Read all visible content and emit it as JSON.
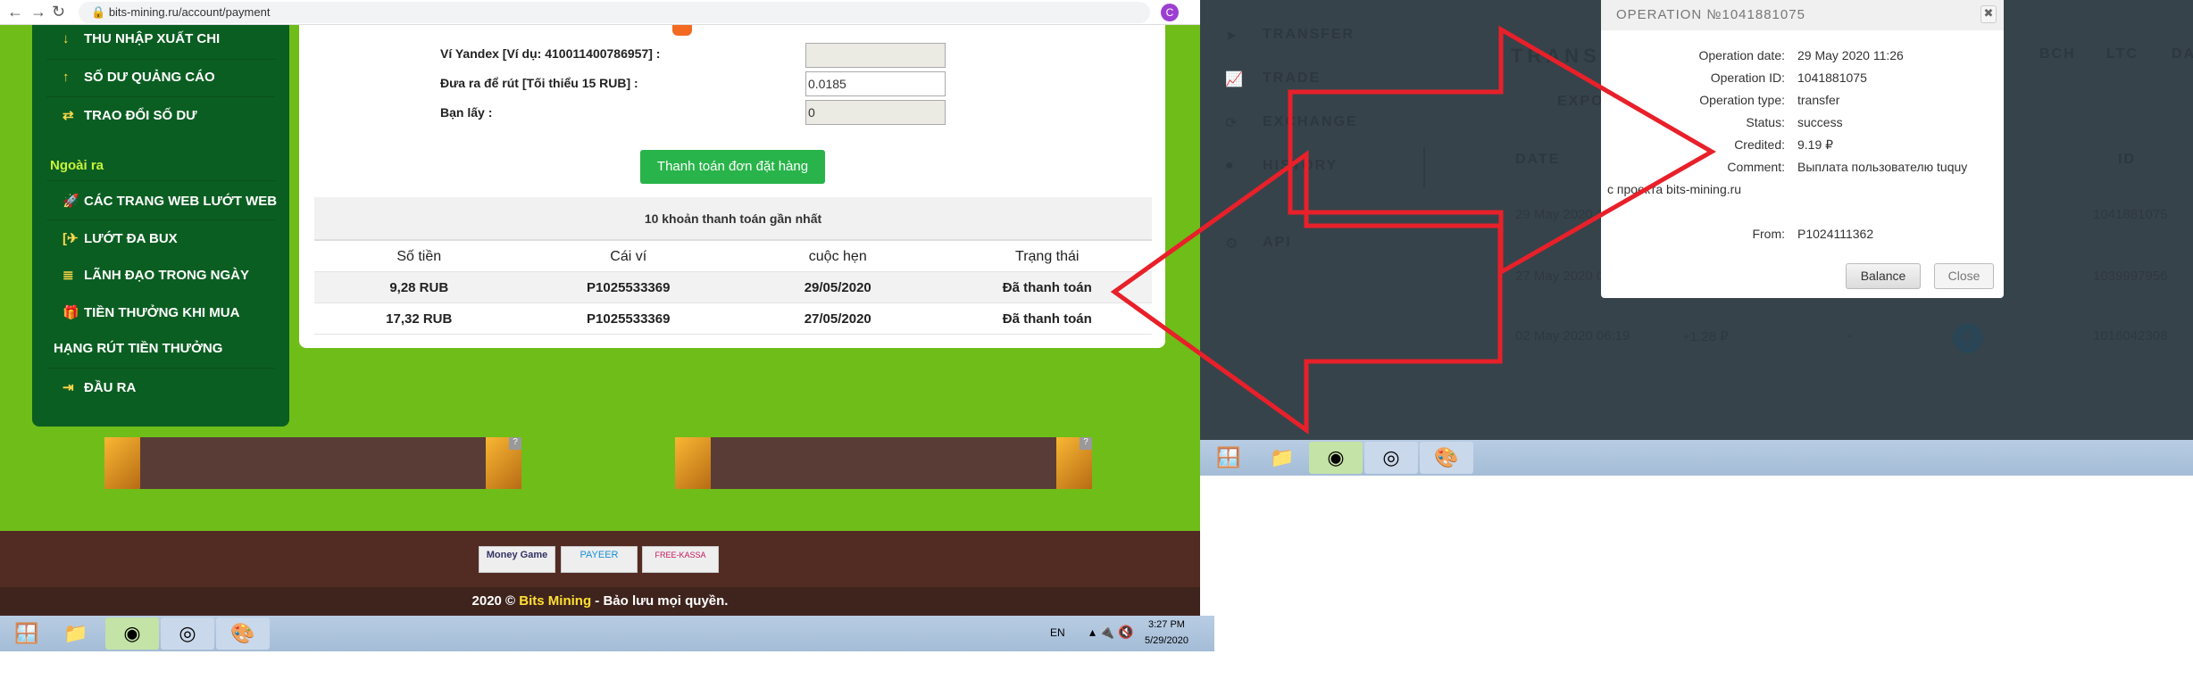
{
  "browser": {
    "url": "bits-mining.ru/account/payment",
    "profile_initial": "C"
  },
  "sidebar": {
    "items": [
      {
        "label": "THU NHẬP XUẤT CHI",
        "icon": "arrow-down-icon"
      },
      {
        "label": "SỐ DƯ QUẢNG CÁO",
        "icon": "arrow-up-icon"
      },
      {
        "label": "TRAO ĐỔI SỐ DƯ",
        "icon": "exchange-icon"
      }
    ],
    "section_title": "Ngoài ra",
    "extra_items": [
      {
        "label": "CÁC TRANG WEB LƯỚT WEB",
        "icon": "rocket-icon"
      },
      {
        "label": "LƯỚT ĐA BUX",
        "icon": "surf-icon"
      },
      {
        "label": "LÃNH ĐẠO TRONG NGÀY",
        "icon": "database-icon"
      },
      {
        "label": "TIỀN THƯỞNG KHI MUA",
        "icon": "gift-icon"
      },
      {
        "label": "HẠNG RÚT TIỀN THƯỞNG",
        "icon": "rank-icon"
      },
      {
        "label": "ĐẦU RA",
        "icon": "sign-out-icon"
      }
    ]
  },
  "form": {
    "wallet_label": "Ví Yandex [Ví dụ: 410011400786957] :",
    "wallet_value": "",
    "amount_label": "Đưa ra để rút [Tối thiểu 15 RUB] :",
    "amount_value": "0.0185",
    "receive_label": "Bạn lấy :",
    "receive_value": "0",
    "submit_label": "Thanh toán đơn đặt hàng"
  },
  "payments": {
    "title": "10 khoản thanh toán gần nhất",
    "columns": [
      "Số tiền",
      "Cái ví",
      "cuộc hẹn",
      "Trạng thái"
    ],
    "rows": [
      [
        "9,28 RUB",
        "P1025533369",
        "29/05/2020",
        "Đã thanh toán"
      ],
      [
        "17,32 RUB",
        "P1025533369",
        "27/05/2020",
        "Đã thanh toán"
      ]
    ]
  },
  "footer": {
    "logos": [
      "Money Game",
      "PAYEER",
      "FREE-KASSA"
    ],
    "copyright_prefix": "2020 © ",
    "brand": "Bits Mining",
    "copyright_suffix": " - Bảo lưu mọi quyền.",
    "brand_color": "#ffe033"
  },
  "taskbar_left": {
    "lang": "EN",
    "time": "3:27 PM",
    "date": "5/29/2020"
  },
  "payeer": {
    "nav": [
      "TRANSFER",
      "TRADE",
      "EXCHANGE",
      "HISTORY",
      "API"
    ],
    "section_title": "TRANSACT",
    "export_label": "EXPORT",
    "currency_tabs": [
      "BCH",
      "LTC",
      "DASH"
    ],
    "columns": {
      "date": "DATE",
      "id": "ID"
    },
    "rows": [
      {
        "date": "29 May 2020 1",
        "amount": "",
        "id": "1041881075"
      },
      {
        "date": "27 May 2020 09",
        "amount": "",
        "id": "1039997956"
      },
      {
        "date": "02 May 2020 06:19",
        "amount": "+1.28 ₽",
        "dash": "-",
        "id": "1016042308"
      }
    ]
  },
  "modal": {
    "title": "OPERATION №1041881075",
    "fields": [
      {
        "label": "Operation date:",
        "value": "29 May 2020 11:26"
      },
      {
        "label": "Operation ID:",
        "value": "1041881075"
      },
      {
        "label": "Operation type:",
        "value": "transfer"
      },
      {
        "label": "Status:",
        "value": "success"
      },
      {
        "label": "Credited:",
        "value": "9.19 ₽"
      },
      {
        "label": "Comment:",
        "value": "Выплата пользователю tuquy"
      }
    ],
    "comment_cont": "с проекта bits-mining.ru",
    "from_label": "From:",
    "from_value": "P1024111362",
    "balance_label": "Balance",
    "close_label": "Close"
  },
  "annotation_color": "#e8202a"
}
